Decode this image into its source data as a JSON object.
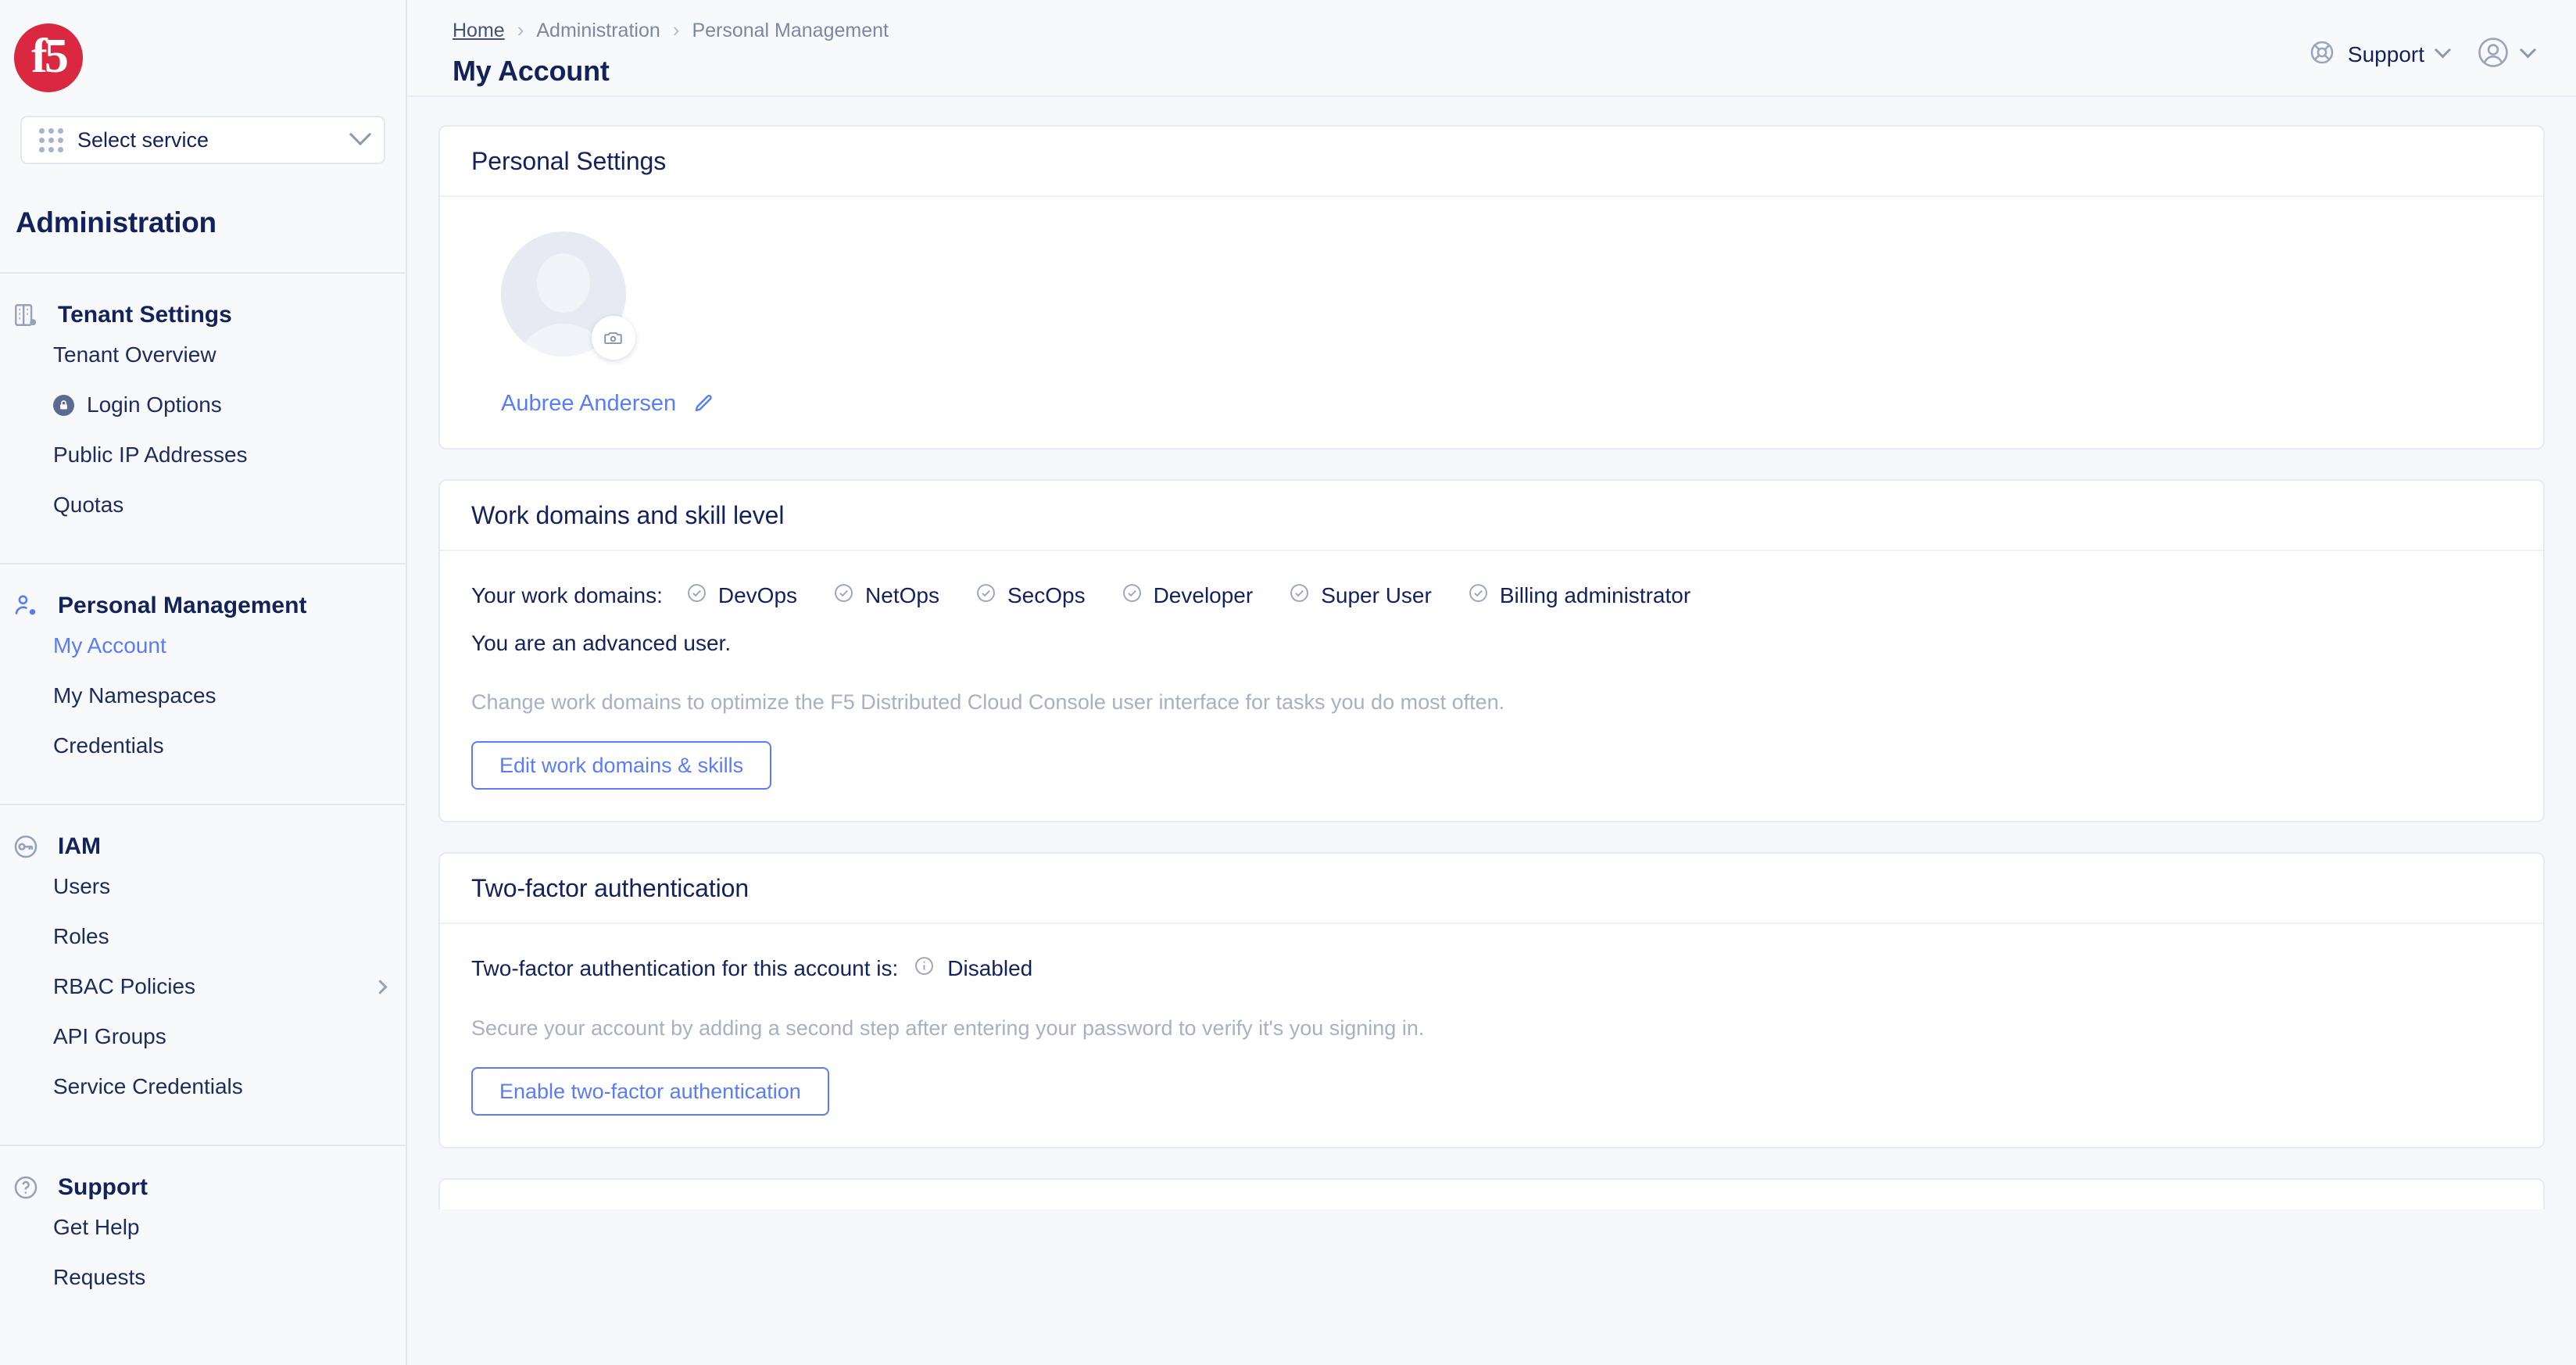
{
  "brand": {
    "logo_text": "f5",
    "logo_color": "#da2841"
  },
  "sidebar": {
    "service_selector": {
      "label": "Select service",
      "icon": "grid-apps-icon",
      "chevron": "chevron-down-icon"
    },
    "title": "Administration",
    "groups": [
      {
        "label": "Tenant Settings",
        "icon": "building-settings-icon",
        "items": [
          {
            "label": "Tenant Overview",
            "active": false
          },
          {
            "label": "Login Options",
            "active": false,
            "badge_icon": "lock-icon"
          },
          {
            "label": "Public IP Addresses",
            "active": false
          },
          {
            "label": "Quotas",
            "active": false
          }
        ]
      },
      {
        "label": "Personal Management",
        "icon": "user-settings-icon",
        "items": [
          {
            "label": "My Account",
            "active": true
          },
          {
            "label": "My Namespaces",
            "active": false
          },
          {
            "label": "Credentials",
            "active": false
          }
        ]
      },
      {
        "label": "IAM",
        "icon": "key-circle-icon",
        "items": [
          {
            "label": "Users",
            "active": false
          },
          {
            "label": "Roles",
            "active": false
          },
          {
            "label": "RBAC Policies",
            "active": false,
            "expand_icon": "chevron-right-icon"
          },
          {
            "label": "API Groups",
            "active": false
          },
          {
            "label": "Service Credentials",
            "active": false
          }
        ]
      },
      {
        "label": "Support",
        "icon": "question-circle-icon",
        "items": [
          {
            "label": "Get Help",
            "active": false
          },
          {
            "label": "Requests",
            "active": false
          }
        ]
      }
    ]
  },
  "topbar": {
    "breadcrumb": {
      "home": "Home",
      "sep": "›",
      "level2": "Administration",
      "level3": "Personal Management"
    },
    "page_title": "My Account",
    "support": {
      "label": "Support",
      "icon": "lifebuoy-icon",
      "chevron": "chevron-down-icon"
    },
    "account": {
      "icon": "user-circle-icon",
      "chevron": "chevron-down-icon"
    }
  },
  "cards": {
    "personal_settings": {
      "title": "Personal Settings",
      "avatar_icon": "avatar-placeholder-icon",
      "camera_icon": "camera-icon",
      "user_name": "Aubree Andersen",
      "edit_icon": "pencil-icon"
    },
    "work_domains": {
      "title": "Work domains and skill level",
      "domains_label": "Your work domains:",
      "domains": [
        {
          "name": "DevOps",
          "icon": "check-circle-icon"
        },
        {
          "name": "NetOps",
          "icon": "check-circle-icon"
        },
        {
          "name": "SecOps",
          "icon": "check-circle-icon"
        },
        {
          "name": "Developer",
          "icon": "check-circle-icon"
        },
        {
          "name": "Super User",
          "icon": "check-circle-icon"
        },
        {
          "name": "Billing administrator",
          "icon": "check-circle-icon"
        }
      ],
      "skill_level": "You are an advanced user.",
      "hint": "Change work domains to optimize the F5 Distributed Cloud Console user interface for tasks you do most often.",
      "edit_button": "Edit work domains & skills"
    },
    "two_factor": {
      "title": "Two-factor authentication",
      "status_label": "Two-factor authentication for this account is:",
      "status_icon": "info-circle-icon",
      "status_value": "Disabled",
      "description": "Secure your account by adding a second step after entering your password to verify it's you signing in.",
      "enable_button": "Enable two-factor authentication"
    }
  },
  "colors": {
    "accent_blue": "#5b7cfa",
    "navy": "#14225c",
    "brand_red": "#da2841",
    "muted": "#a8b0c4"
  }
}
